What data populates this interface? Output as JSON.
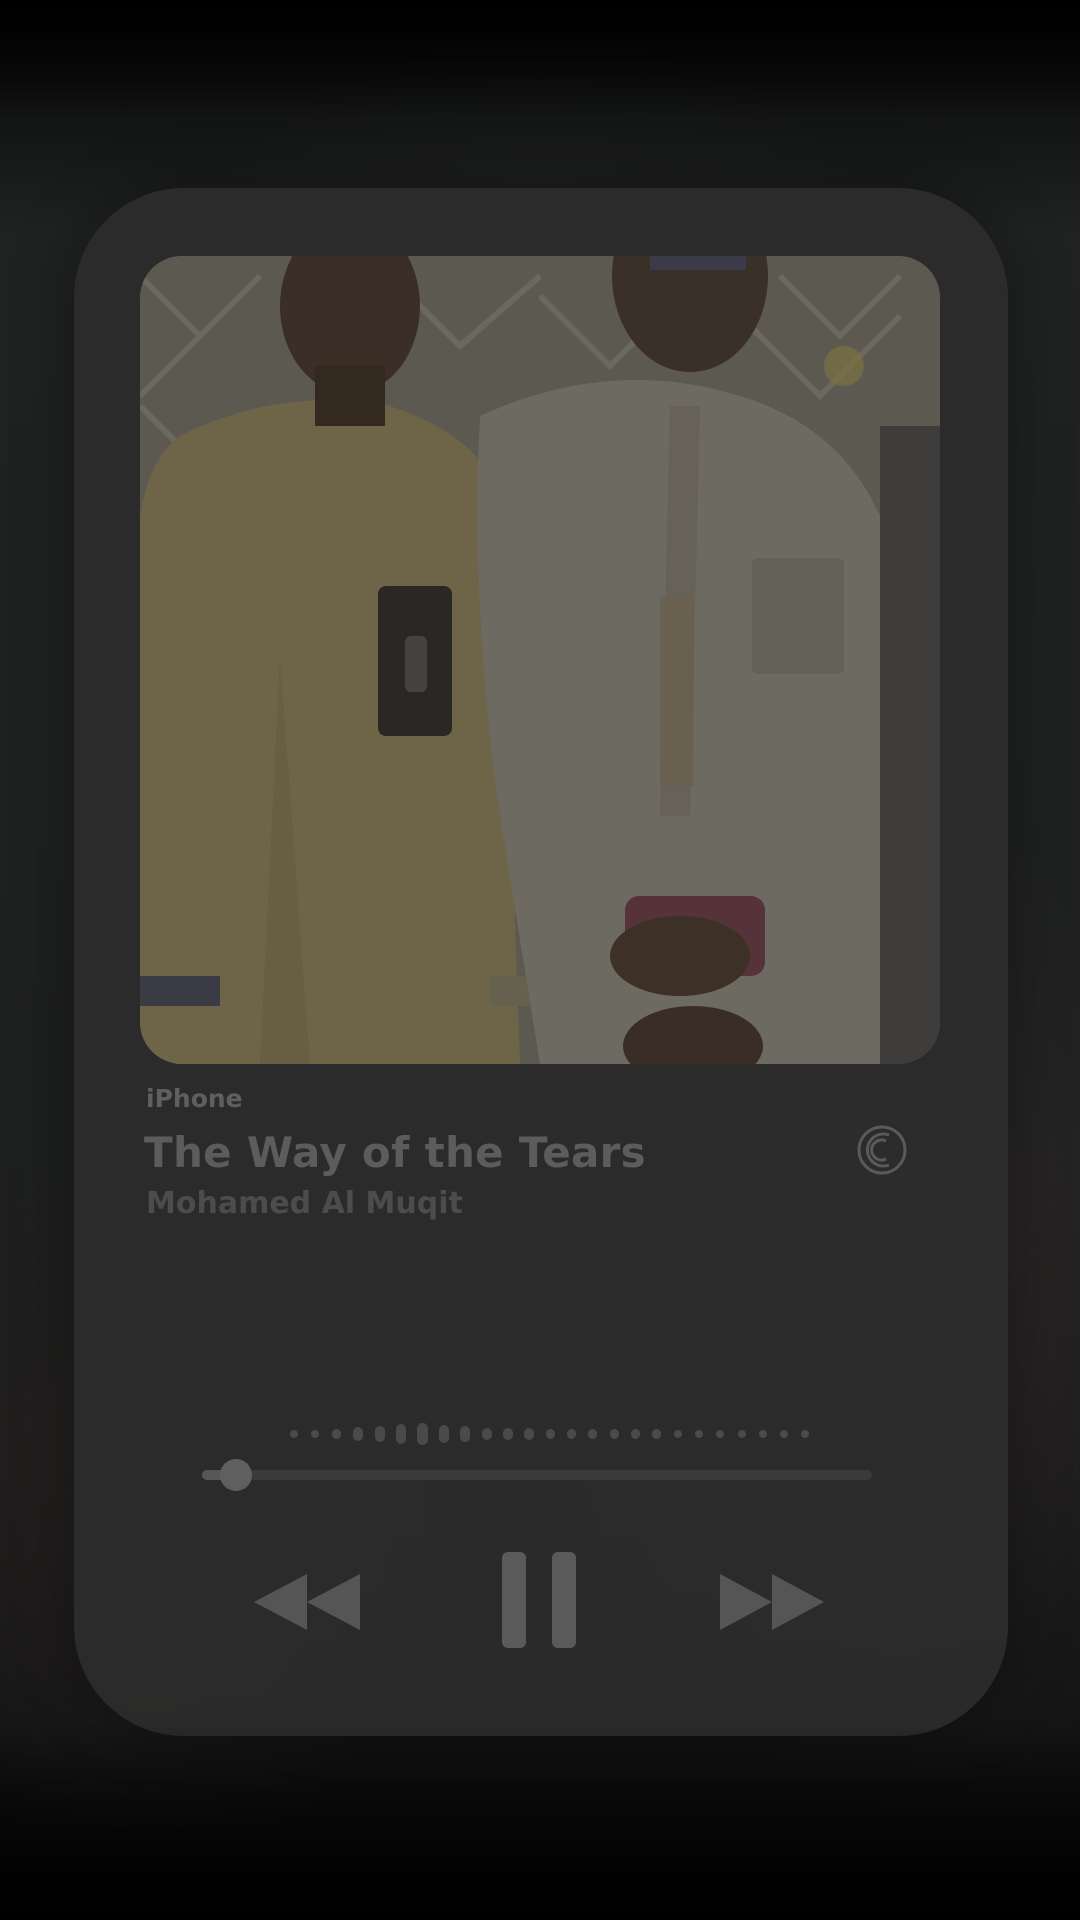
{
  "player": {
    "source": "iPhone",
    "title": "The Way of the Tears",
    "artist": "Mohamed Al Muqit",
    "progress": 0.05
  },
  "icons": {
    "output": "airplay-icon",
    "rewind": "backward-icon",
    "pause": "pause-icon",
    "forward": "forward-icon"
  },
  "colors": {
    "card": "#2c2c2c",
    "text_primary": "#5c5c5c",
    "text_secondary": "#4c4c4c"
  }
}
